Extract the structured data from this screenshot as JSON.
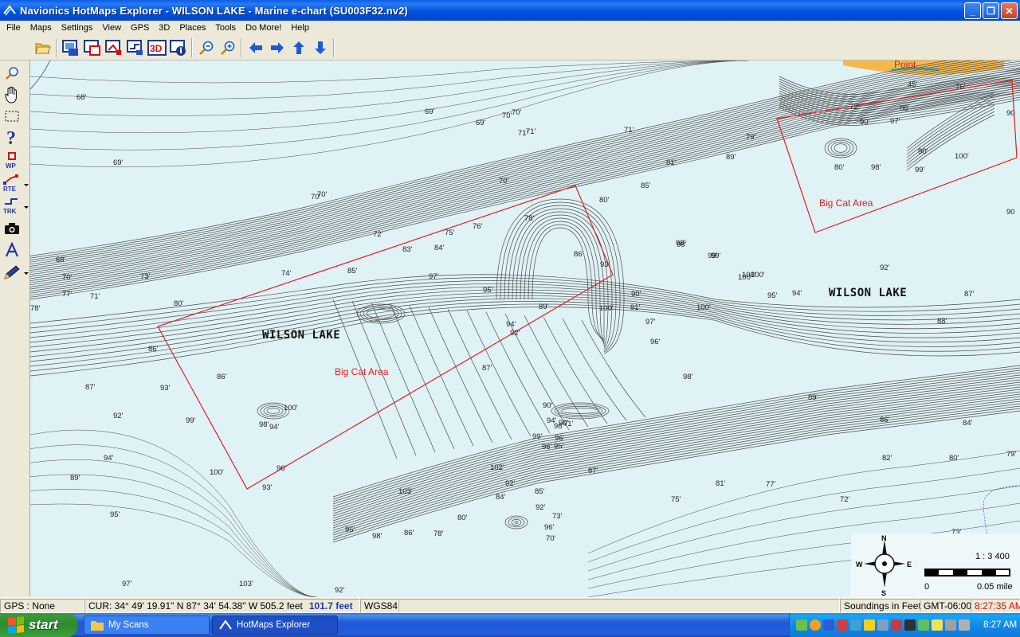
{
  "window": {
    "title": "Navionics HotMaps Explorer - WILSON LAKE - Marine e-chart  (SU003F32.nv2)",
    "minimize": "_",
    "maximize": "❐",
    "close": "✕"
  },
  "menu": [
    "File",
    "Maps",
    "Settings",
    "View",
    "GPS",
    "3D",
    "Places",
    "Tools",
    "Do More!",
    "Help"
  ],
  "toolbar": {
    "buttons": [
      "open-folder-icon",
      "map-window-icon",
      "map-red-icon",
      "map-route-icon",
      "map-track-icon",
      "3d-view-icon",
      "map-info-icon",
      "zoom-out-icon",
      "zoom-in-icon",
      "pan-left-icon",
      "pan-right-icon",
      "pan-up-icon",
      "pan-down-icon"
    ],
    "three_d_label": "3D"
  },
  "left_tools": [
    "zoom-tool-icon",
    "hand-pan-icon",
    "select-rect-icon",
    "help-icon",
    "waypoint-icon",
    "route-icon",
    "track-icon",
    "camera-icon",
    "text-tool-icon",
    "pen-tool-icon"
  ],
  "left_tool_labels": {
    "waypoint": "WP",
    "route": "RTE",
    "track": "TRK",
    "help": "?"
  },
  "map": {
    "title_label_1": "WILSON LAKE",
    "title_label_2": "WILSON LAKE",
    "point_label": "Point",
    "area_label_1": "Big Cat Area",
    "area_label_2": "Big Cat Area",
    "soundings": [
      "68'",
      "69'",
      "70'",
      "70'",
      "71'",
      "71'",
      "73'",
      "77'",
      "78'",
      "80'",
      "68'",
      "70'",
      "72'",
      "74'",
      "75'",
      "76'",
      "78'",
      "83'",
      "84'",
      "85'",
      "86'",
      "86'",
      "87'",
      "89'",
      "90'",
      "91'",
      "92'",
      "93'",
      "94'",
      "95'",
      "96'",
      "97'",
      "97'",
      "98'",
      "99'",
      "100'",
      "100'",
      "80'",
      "81'",
      "85'",
      "79'",
      "89'",
      "98'",
      "99'",
      "100'",
      "72'",
      "86'",
      "90'",
      "97'",
      "90'",
      "100'",
      "80'",
      "98'",
      "99'",
      "76'",
      "45'",
      "90",
      "90",
      "92'",
      "94'",
      "95'",
      "87'",
      "88'",
      "98'",
      "89'",
      "86'",
      "84'",
      "82'",
      "80'",
      "79'",
      "81'",
      "77'",
      "72'",
      "75'",
      "87'",
      "85'",
      "84'",
      "80'",
      "78'",
      "86'",
      "98'",
      "95'",
      "92'",
      "103'",
      "97'",
      "89'",
      "94'",
      "95'",
      "87'",
      "92'",
      "93'",
      "99'",
      "86'",
      "98'",
      "100'",
      "94'",
      "93'",
      "100'",
      "96'",
      "103'",
      "102'",
      "92'",
      "96'",
      "99'",
      "90'",
      "98'",
      "73'",
      "71'",
      "70'",
      "96'",
      "90'",
      "92'",
      "94'",
      "95'",
      "96'",
      "71'",
      "69'",
      "69'",
      "70'",
      "70'",
      "71'",
      "100'",
      "100'",
      "70'",
      "78'",
      "73'"
    ],
    "compass": {
      "n": "N",
      "s": "S",
      "e": "E",
      "w": "W"
    },
    "scale_ratio": "1 : 3 400",
    "scale_left": "0",
    "scale_right": "0.05 mile"
  },
  "status": {
    "gps": "GPS : None",
    "cursor": "CUR: 34° 49' 19.91\" N 87° 34' 54.38\" W  505.2 feet",
    "distance": "101.7 feet",
    "datum": "WGS84",
    "soundings_unit": "Soundings in Feet",
    "timezone": "GMT-06:00",
    "time": "8:27:35 AM"
  },
  "taskbar": {
    "start": "start",
    "items": [
      "My Scans",
      "HotMaps Explorer"
    ],
    "clock": "8:27 AM"
  },
  "colors": {
    "water": "#dff2f6",
    "contour": "#555555",
    "area_outline": "#e02020",
    "land": "#f5b94a",
    "xp_blue": "#245edb"
  }
}
